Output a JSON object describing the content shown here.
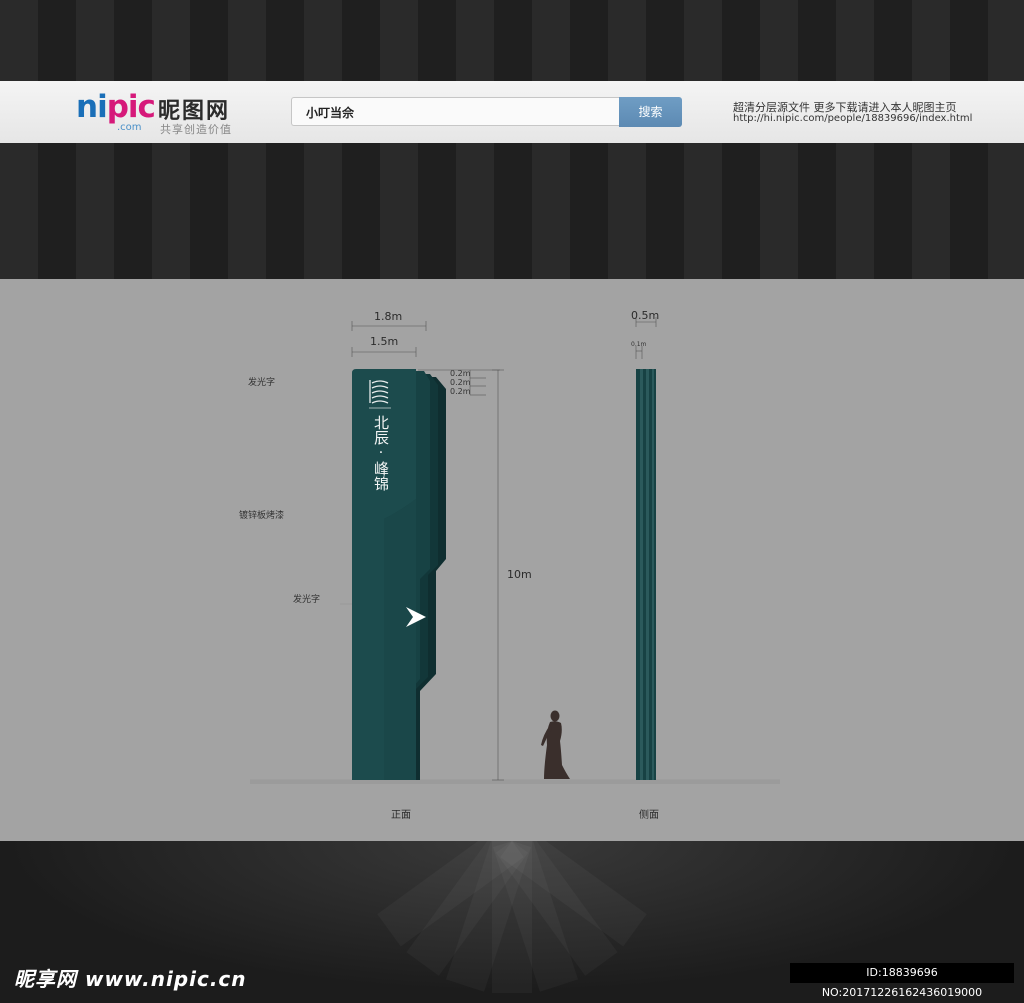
{
  "site": {
    "logo_latin_a": "ni",
    "logo_latin_b": "pic",
    "logo_cn": "昵图网",
    "logo_com": ".com",
    "slogan": "共享创造价值"
  },
  "search": {
    "value": "小叮当佘",
    "button_label": "搜索"
  },
  "header_note": {
    "line1": "超清分层源文件  更多下载请进入本人昵图主页",
    "url": "http://hi.nipic.com/people/18839696/index.html"
  },
  "drawing": {
    "front": {
      "width_outer": "1.8m",
      "width_inner": "1.5m",
      "step_labels": [
        "0.2m",
        "0.2m",
        "0.2m"
      ],
      "height": "10m",
      "sign_line1": "北辰",
      "sign_dot": "·",
      "sign_line2": "峰锦",
      "caption": "正面"
    },
    "side": {
      "width": "0.5m",
      "sub_width": "0.1m",
      "caption": "侧面"
    },
    "notes": [
      "发光字",
      "镀锌板烤漆",
      "发光字"
    ],
    "colors": {
      "panel": "#a3a3a3",
      "sign_dark": "#153f41",
      "sign_mid": "#1c4a4c",
      "sign_back": "#0f2e30"
    }
  },
  "footer": {
    "logo_text": "昵享网 www.nipic.cn",
    "id_text": "ID:18839696 NO:20171226162436019000"
  }
}
